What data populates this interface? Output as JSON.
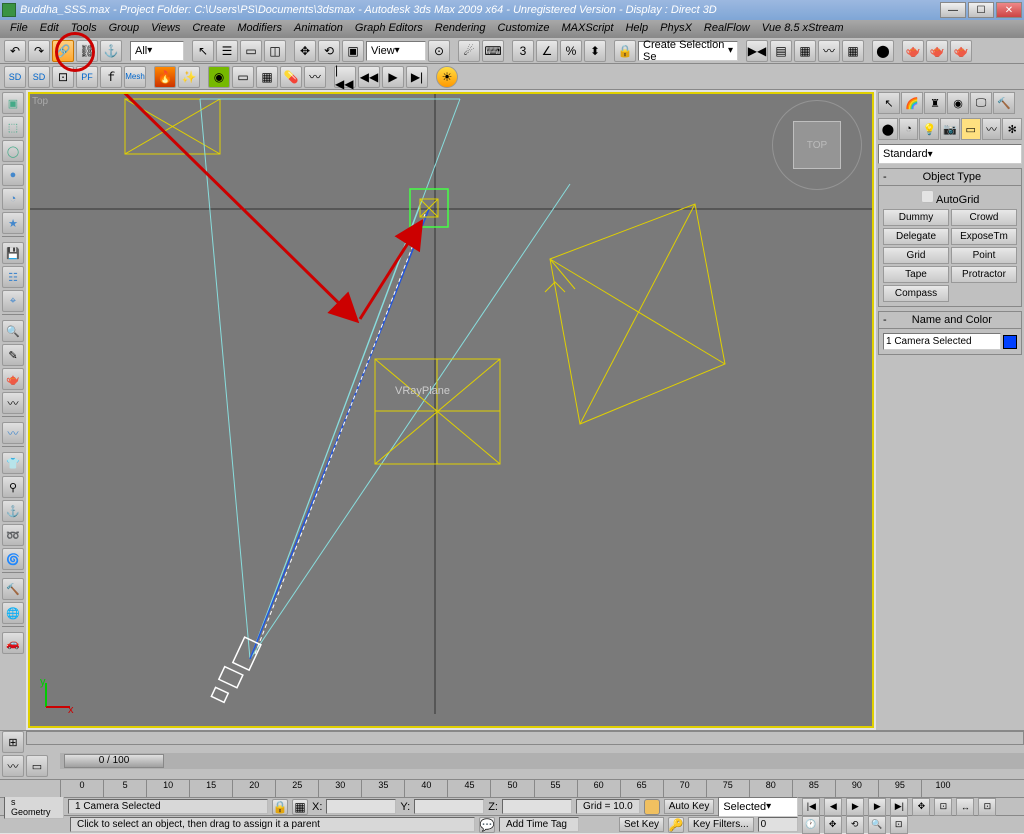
{
  "title": "Buddha_SSS.max     -  Project Folder: C:\\Users\\PS\\Documents\\3dsmax              -  Autodesk 3ds Max  2009 x64  - Unregistered Version       -  Display : Direct 3D",
  "menus": [
    "File",
    "Edit",
    "Tools",
    "Group",
    "Views",
    "Create",
    "Modifiers",
    "Animation",
    "Graph Editors",
    "Rendering",
    "Customize",
    "MAXScript",
    "Help",
    "PhysX",
    "RealFlow",
    "Vue 8.5 xStream"
  ],
  "toolbar1": {
    "filter": "All",
    "view": "View",
    "selset": "Create Selection Se"
  },
  "viewport": {
    "label": "Top",
    "cube": "TOP",
    "objlabel": "VRayPlane"
  },
  "command": {
    "dropdown": "Standard",
    "rollout1": "Object Type",
    "autogrid": "AutoGrid",
    "buttons": [
      "Dummy",
      "Crowd",
      "Delegate",
      "ExposeTm",
      "Grid",
      "Point",
      "Tape",
      "Protractor",
      "Compass",
      ""
    ],
    "rollout2": "Name and Color",
    "name": "1 Camera Selected"
  },
  "slider": "0 / 100",
  "ticks": [
    "0",
    "5",
    "10",
    "15",
    "20",
    "25",
    "30",
    "35",
    "40",
    "45",
    "50",
    "55",
    "60",
    "65",
    "70",
    "75",
    "80",
    "85",
    "90",
    "95",
    "100"
  ],
  "status": {
    "sel": "1 Camera Selected",
    "hint": "Click to select an object, then drag to assign it a parent",
    "geom": "s Geometry",
    "x": "X:",
    "y": "Y:",
    "z": "Z:",
    "grid": "Grid = 10.0",
    "autokey": "Auto Key",
    "setkey": "Set Key",
    "selected": "Selected",
    "keyfilters": "Key Filters...",
    "addtag": "Add Time Tag"
  }
}
